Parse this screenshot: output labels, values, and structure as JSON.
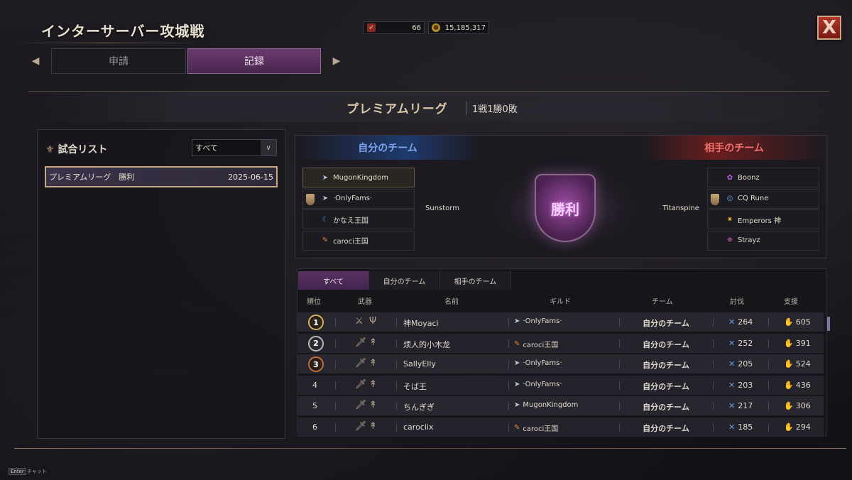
{
  "header": {
    "title": "インターサーバー攻城戦",
    "currency1": {
      "icon": "arrow-ticket-icon",
      "value": "66"
    },
    "currency2": {
      "icon": "gold-coin-icon",
      "value": "15,185,317"
    },
    "close_label": "X"
  },
  "tabs": {
    "apply": "申請",
    "record": "記録",
    "active": "record"
  },
  "league": {
    "name": "プレミアムリーグ",
    "record": "1戦1勝0敗"
  },
  "match_list": {
    "title": "試合リスト",
    "filter": "すべて",
    "items": [
      {
        "name": "プレミアムリーグ　勝利",
        "date": "2025-06-15"
      }
    ]
  },
  "teams": {
    "my_team_label": "自分のチーム",
    "enemy_team_label": "相手のチーム",
    "my_server": "Sunstorm",
    "enemy_server": "Titanspine",
    "result": "勝利",
    "my_guilds": [
      {
        "name": "MugonKingdom",
        "icon": "shark-icon",
        "leader": false,
        "highlight": true
      },
      {
        "name": "·OnlyFams·",
        "icon": "shark-icon",
        "leader": true,
        "highlight": false
      },
      {
        "name": "かなえ王国",
        "icon": "moon-icon",
        "leader": false,
        "highlight": false
      },
      {
        "name": "caroci王国",
        "icon": "carrot-icon",
        "leader": false,
        "highlight": false
      }
    ],
    "enemy_guilds": [
      {
        "name": "Boonz",
        "icon": "flower-icon",
        "leader": false
      },
      {
        "name": "CQ Rune",
        "icon": "rune-icon",
        "leader": true
      },
      {
        "name": "Emperors 神",
        "icon": "star-icon",
        "leader": false
      },
      {
        "name": "Strayz",
        "icon": "wheel-icon",
        "leader": false
      }
    ]
  },
  "stats": {
    "tabs": [
      "すべて",
      "自分のチーム",
      "相手のチーム"
    ],
    "active_tab": 0,
    "columns": {
      "rank": "順位",
      "weapon": "武器",
      "name": "名前",
      "guild": "ギルド",
      "team": "チーム",
      "kills": "討伐",
      "support": "支援"
    },
    "rows": [
      {
        "rank": "1",
        "name": "神Moyaci",
        "guild": "·OnlyFams·",
        "guild_icon": "shark-icon",
        "team": "自分のチーム",
        "kills": "264",
        "support": "605"
      },
      {
        "rank": "2",
        "name": "烦人的小木龙",
        "guild": "caroci王国",
        "guild_icon": "carrot-icon",
        "team": "自分のチーム",
        "kills": "252",
        "support": "391"
      },
      {
        "rank": "3",
        "name": "SallyElly",
        "guild": "·OnlyFams·",
        "guild_icon": "shark-icon",
        "team": "自分のチーム",
        "kills": "205",
        "support": "524"
      },
      {
        "rank": "4",
        "name": "そば王",
        "guild": "·OnlyFams·",
        "guild_icon": "shark-icon",
        "team": "自分のチーム",
        "kills": "203",
        "support": "436"
      },
      {
        "rank": "5",
        "name": "ちんぎぎ",
        "guild": "MugonKingdom",
        "guild_icon": "shark-icon",
        "team": "自分のチーム",
        "kills": "217",
        "support": "306"
      },
      {
        "rank": "6",
        "name": "carociix",
        "guild": "caroci王国",
        "guild_icon": "carrot-icon",
        "team": "自分のチーム",
        "kills": "185",
        "support": "294"
      }
    ]
  },
  "footer": {
    "key": "Enter",
    "label": "チャット"
  }
}
